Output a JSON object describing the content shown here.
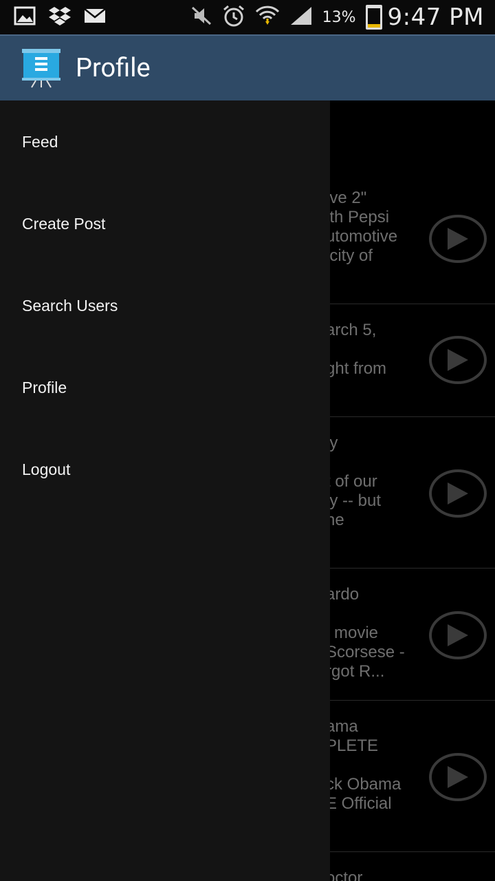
{
  "status_bar": {
    "battery_percent": "13%",
    "time": "9:47 PM",
    "icons_left": [
      "gallery-icon",
      "dropbox-icon",
      "mail-icon"
    ],
    "icons_right": [
      "mute-icon",
      "alarm-icon",
      "wifi-icon",
      "signal-icon"
    ]
  },
  "action_bar": {
    "title": "Profile",
    "logo_icon": "presentation-board-icon"
  },
  "drawer": {
    "items": [
      {
        "label": "Feed"
      },
      {
        "label": "Create Post"
      },
      {
        "label": "Search Users"
      },
      {
        "label": "Profile"
      },
      {
        "label": "Logout"
      }
    ]
  },
  "feed": {
    "rows": [
      {
        "text": "ive 2\"\nith Pepsi\nutomotive\nicity of"
      },
      {
        "text": "arch 5,\n\nght from"
      },
      {
        "text": "ly\n\nt of our\nly -- but\nne"
      },
      {
        "text": "ardo\n\nl movie\nScorsese -\nrgot R..."
      },
      {
        "text": "ama\nPLETE\n\nck Obama\nE Official"
      },
      {
        "text": "octor"
      }
    ],
    "play_icon": "play-icon"
  },
  "colors": {
    "action_bar_bg": "#2f4a66",
    "drawer_bg": "#141414",
    "logo_blue": "#29a9e1"
  }
}
